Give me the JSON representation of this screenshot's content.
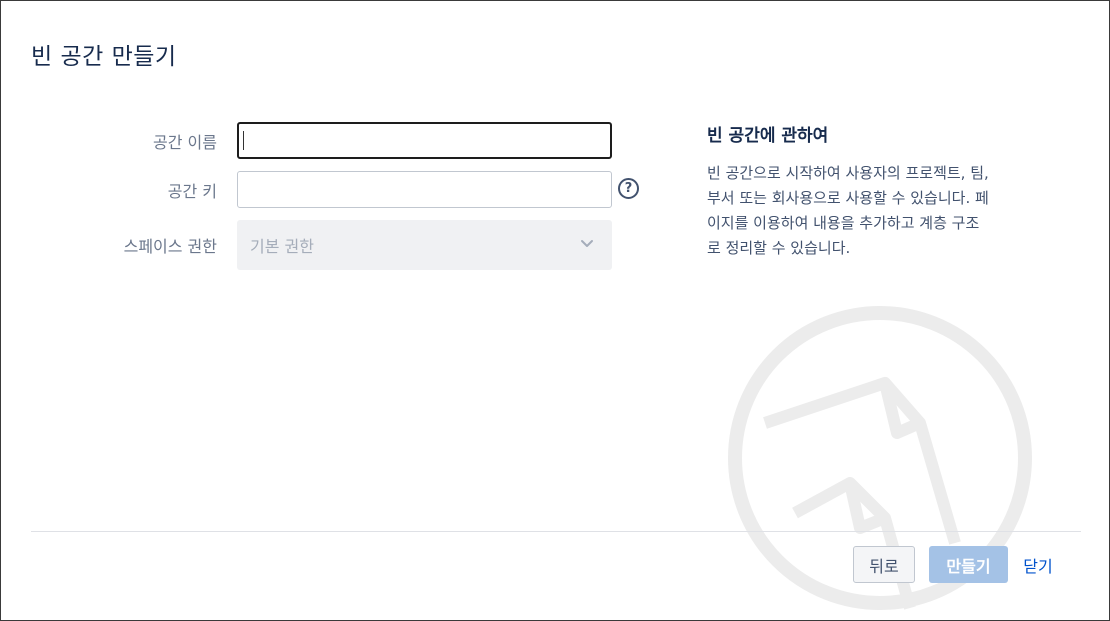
{
  "dialog": {
    "title": "빈 공간 만들기"
  },
  "form": {
    "space_name_label": "공간 이름",
    "space_name_value": "",
    "space_key_label": "공간 키",
    "space_key_value": "",
    "permission_label": "스페이스 권한",
    "permission_selected": "기본 권한"
  },
  "about": {
    "title": "빈 공간에 관하여",
    "line1": "빈 공간으로 시작하여 사용자의 프로젝트, 팀,",
    "line2": "부서 또는 회사용으로 사용할 수 있습니다. 페",
    "line3": "이지를 이용하여 내용을 추가하고 계층 구조",
    "line4": "로 정리할 수 있습니다."
  },
  "footer": {
    "back_label": "뒤로",
    "create_label": "만들기",
    "close_label": "닫기"
  },
  "icons": {
    "help": "help-icon",
    "chevron": "chevron-down-icon",
    "watermark": "blank-page-icon"
  },
  "colors": {
    "primary_disabled": "#a4c2e6",
    "link": "#0052cc",
    "title": "#172b4d"
  }
}
